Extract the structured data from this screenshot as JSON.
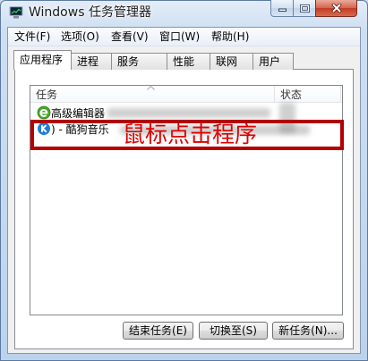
{
  "window": {
    "title": "Windows 任务管理器",
    "icon": "task-manager-icon"
  },
  "caption_buttons": {
    "minimize_icon": "minimize-icon",
    "maximize_icon": "maximize-icon",
    "close_icon": "close-icon"
  },
  "menu": {
    "items": [
      {
        "label": "文件(F)"
      },
      {
        "label": "选项(O)"
      },
      {
        "label": "查看(V)"
      },
      {
        "label": "窗口(W)"
      },
      {
        "label": "帮助(H)"
      }
    ]
  },
  "tabs": [
    {
      "label": "应用程序",
      "selected": true
    },
    {
      "label": "进程",
      "selected": false
    },
    {
      "label": "服务",
      "selected": false
    },
    {
      "label": "性能",
      "selected": false
    },
    {
      "label": "联网",
      "selected": false
    },
    {
      "label": "用户",
      "selected": false
    }
  ],
  "task_list": {
    "columns": [
      {
        "label": "任务"
      },
      {
        "label": "状态"
      }
    ],
    "rows": [
      {
        "name": "高级编辑器",
        "icon": "green-e-icon"
      },
      {
        "name": ") - 酷狗音乐",
        "icon": "kugou-k-icon"
      }
    ]
  },
  "annotation": {
    "text": "鼠标点击程序",
    "color": "#b30000"
  },
  "buttons": {
    "end_task": "结束任务(E)",
    "switch_to": "切换至(S)",
    "new_task": "新任务(N)..."
  },
  "colors": {
    "frame": "#bcd2ec",
    "close_button": "#c43a22",
    "annotation_text": "#e00000",
    "client_bg": "#f0f0f0"
  }
}
